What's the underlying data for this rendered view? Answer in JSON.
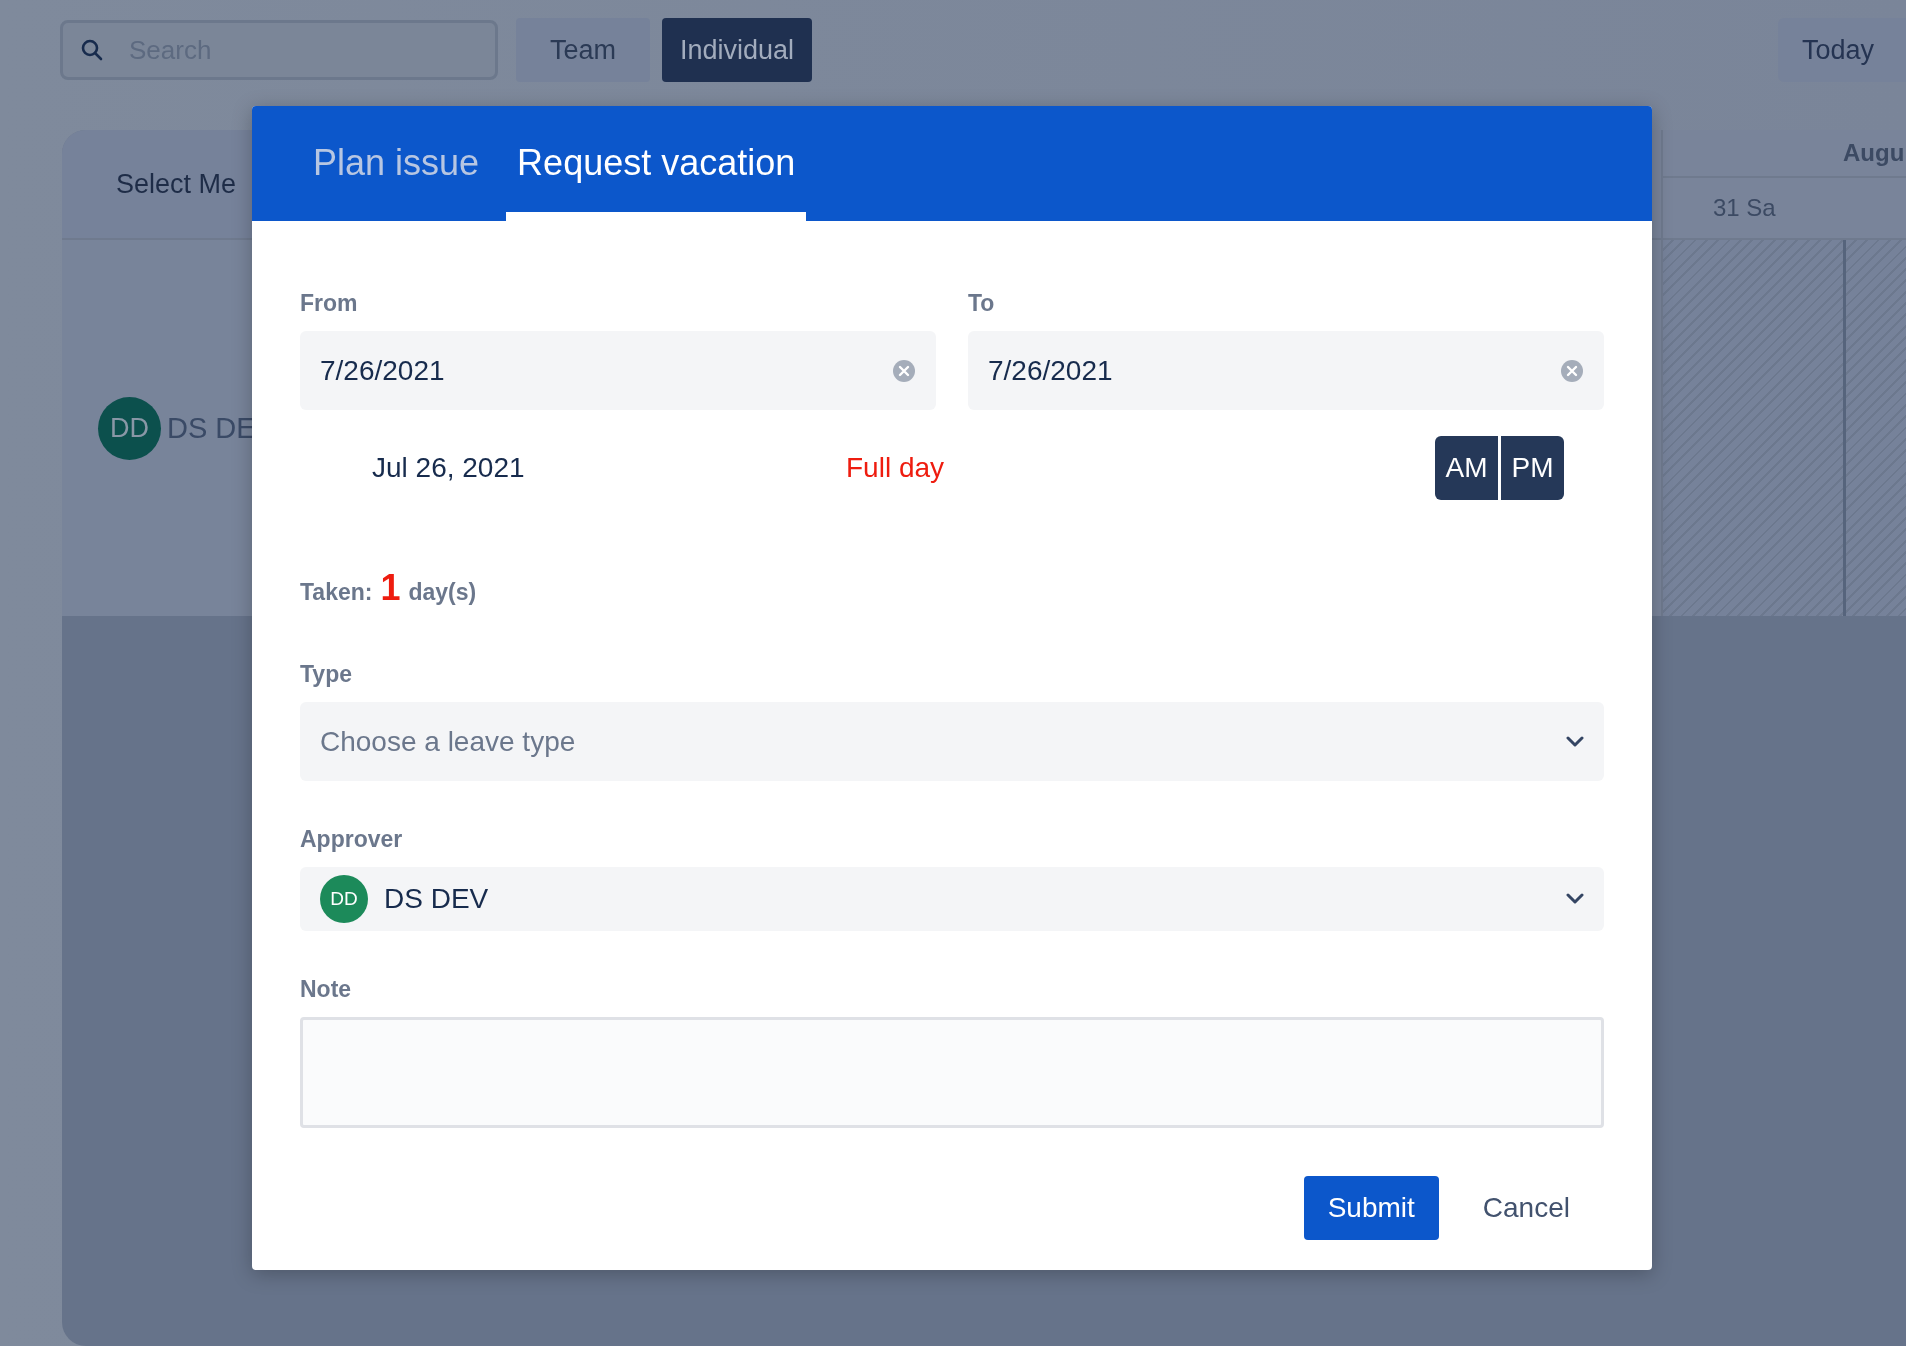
{
  "toolbar": {
    "search": {
      "placeholder": "Search"
    },
    "views": [
      {
        "label": "Team",
        "selected": false
      },
      {
        "label": "Individual",
        "selected": true
      }
    ],
    "today": "Today"
  },
  "timeline": {
    "header": "Select Me",
    "month": "Augu",
    "day": "31 Sa",
    "members": [
      {
        "initials": "DD",
        "name": "DS DE"
      }
    ]
  },
  "dialog": {
    "tabs": [
      {
        "label": "Plan issue",
        "selected": false
      },
      {
        "label": "Request vacation",
        "selected": true
      }
    ],
    "from": {
      "label": "From",
      "value": "7/26/2021"
    },
    "to": {
      "label": "To",
      "value": "7/26/2021"
    },
    "date_text": "Jul 26, 2021",
    "duration": "Full day",
    "half_day": [
      "AM",
      "PM"
    ],
    "taken": {
      "label": "Taken:",
      "count": "1",
      "unit": "day(s)"
    },
    "type": {
      "label": "Type",
      "placeholder": "Choose a leave type"
    },
    "approver": {
      "label": "Approver",
      "initials": "DD",
      "name": "DS DEV"
    },
    "note": {
      "label": "Note"
    },
    "buttons": [
      {
        "label": "Submit",
        "kind": "primary"
      },
      {
        "label": "Cancel",
        "kind": "subtle"
      }
    ]
  }
}
